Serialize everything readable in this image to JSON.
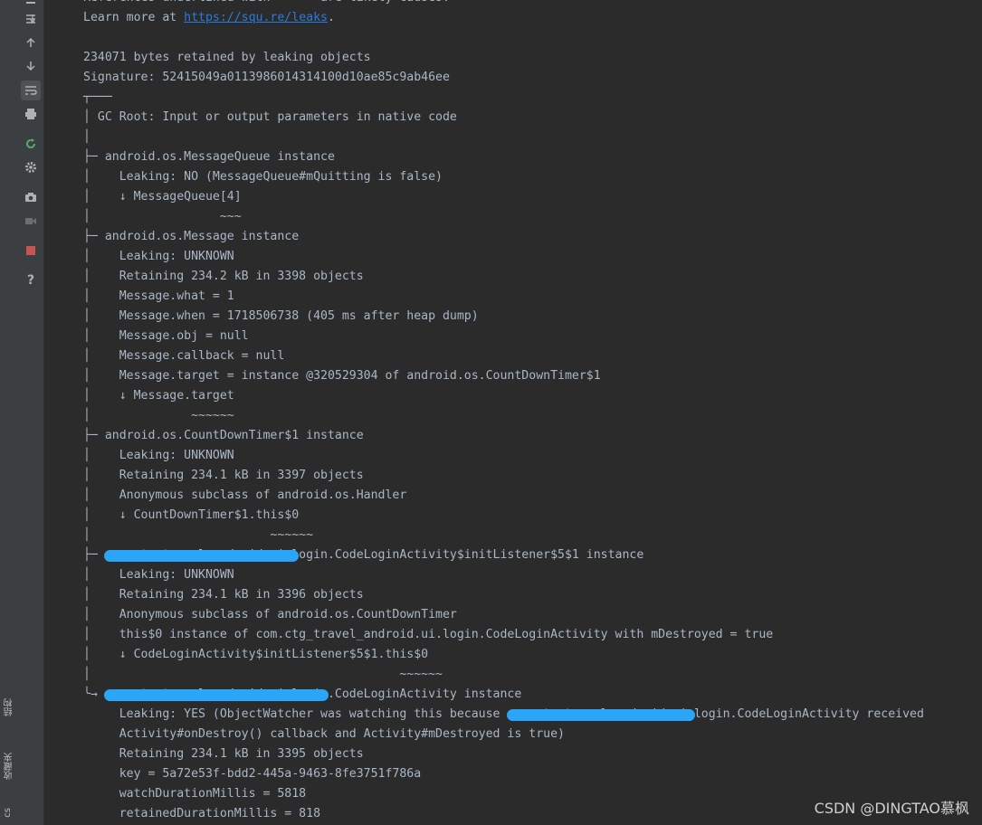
{
  "left_strip": {
    "structure_label": "结构",
    "favorites_label": "收藏夹",
    "bottom_label": "cs"
  },
  "toolbar": {
    "icons": [
      "minus-icon",
      "scroll-to-end-icon",
      "arrow-up-icon",
      "arrow-down-icon",
      "soft-wrap-icon",
      "print-icon",
      "rerun-icon",
      "settings-icon",
      "screenshot-icon",
      "record-video-icon",
      "stop-icon",
      "help-icon"
    ]
  },
  "console": {
    "lines": [
      "References underlined with \"~~~\" are likely causes.",
      "Learn more at ",
      "",
      "234071 bytes retained by leaking objects",
      "Signature: 52415049a0113986014314100d10ae85c9ab46ee",
      "┬───",
      "│ GC Root: Input or output parameters in native code",
      "│",
      "├─ android.os.MessageQueue instance",
      "│    Leaking: NO (MessageQueue#mQuitting is false)",
      "│    ↓ MessageQueue[4]",
      "│                  ~~~",
      "├─ android.os.Message instance",
      "│    Leaking: UNKNOWN",
      "│    Retaining 234.2 kB in 3398 objects",
      "│    Message.what = 1",
      "│    Message.when = 1718506738 (405 ms after heap dump)",
      "│    Message.obj = null",
      "│    Message.callback = null",
      "│    Message.target = instance @320529304 of android.os.CountDownTimer$1",
      "│    ↓ Message.target",
      "│              ~~~~~~",
      "├─ android.os.CountDownTimer$1 instance",
      "│    Leaking: UNKNOWN",
      "│    Retaining 234.1 kB in 3397 objects",
      "│    Anonymous subclass of android.os.Handler",
      "│    ↓ CountDownTimer$1.this$0",
      "│                         ~~~~~~",
      "├─ com.ctg_travel_android.ui.login.CodeLoginActivity$initListener$5$1 instance",
      "│    Leaking: UNKNOWN",
      "│    Retaining 234.1 kB in 3396 objects",
      "│    Anonymous subclass of android.os.CountDownTimer",
      "│    this$0 instance of com.ctg_travel_android.ui.login.CodeLoginActivity with mDestroyed = true",
      "│    ↓ CodeLoginActivity$initListener$5$1.this$0",
      "│                                           ~~~~~~",
      "╰→ com.ctg_travel_android.ui.login.CodeLoginActivity instance",
      "     Leaking: YES (ObjectWatcher was watching this because com.ctg_travel_android.ui.login.CodeLoginActivity received",
      "     Activity#onDestroy() callback and Activity#mDestroyed is true)",
      "     Retaining 234.1 kB in 3395 objects",
      "     key = 5a72e53f-bdd2-445a-9463-8fe3751f786a",
      "     watchDurationMillis = 5818",
      "     retainedDurationMillis = 818"
    ],
    "link_text": "https://squ.re/leaks",
    "link_suffix": "."
  },
  "watermark": "CSDN @DINGTAO慕枫",
  "colors": {
    "background": "#2b2b2b",
    "text": "#a9b7c6",
    "link": "#287bde",
    "redaction": "#2aa5f7"
  }
}
